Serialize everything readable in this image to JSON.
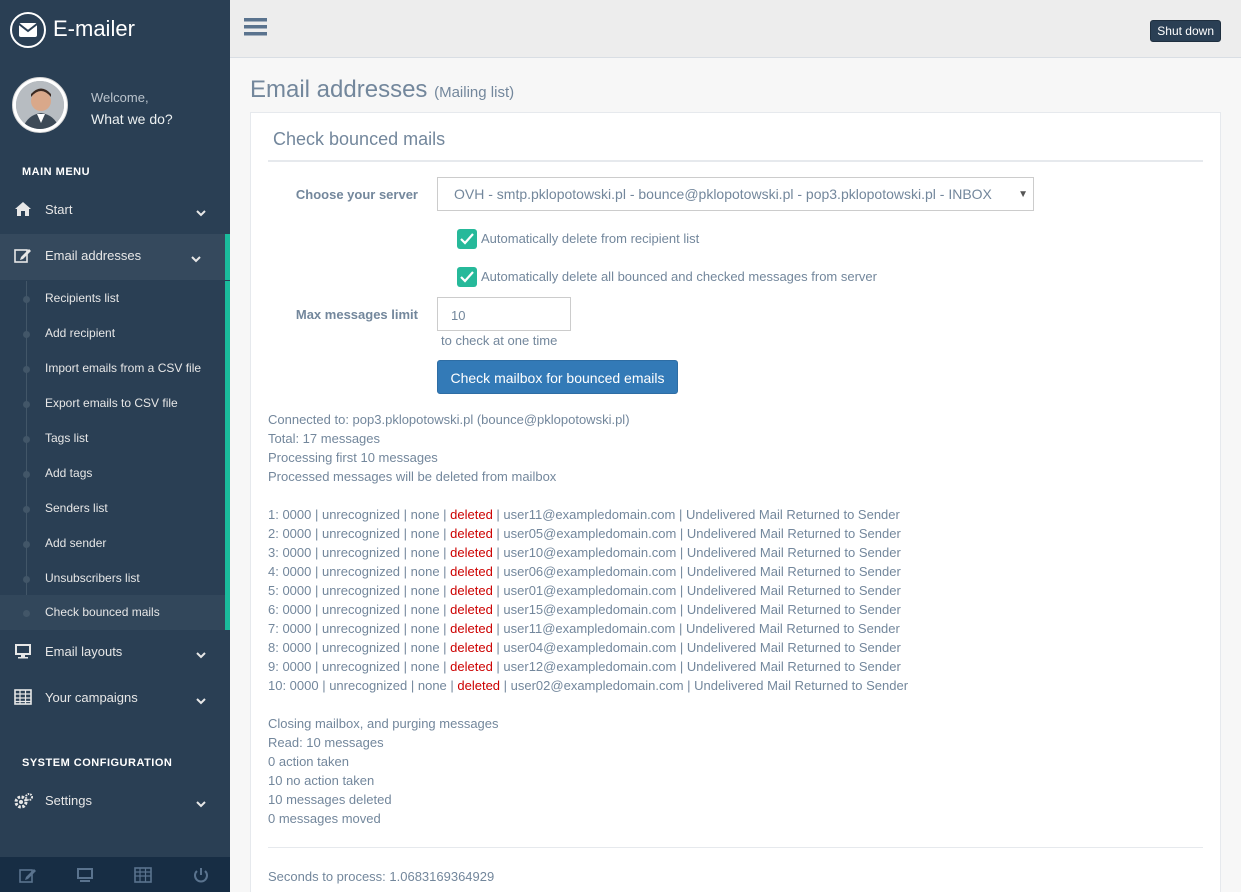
{
  "app": {
    "title": "E-mailer"
  },
  "profile": {
    "welcome": "Welcome,",
    "name": "What we do?"
  },
  "sidebar": {
    "main_menu_title": "MAIN MENU",
    "system_title": "SYSTEM CONFIGURATION",
    "items": [
      {
        "label": "Start",
        "icon": "home-icon"
      },
      {
        "label": "Email addresses",
        "icon": "edit-icon"
      },
      {
        "label": "Email layouts",
        "icon": "desktop-icon"
      },
      {
        "label": "Your campaigns",
        "icon": "table-icon"
      },
      {
        "label": "Settings",
        "icon": "cogs-icon"
      }
    ],
    "submenu": [
      "Recipients list",
      "Add recipient",
      "Import emails from a CSV file",
      "Export emails to CSV file",
      "Tags list",
      "Add tags",
      "Senders list",
      "Add sender",
      "Unsubscribers list",
      "Check bounced mails"
    ],
    "footer_icons": [
      "edit-icon",
      "desktop-icon",
      "table-icon",
      "power-icon"
    ]
  },
  "topnav": {
    "shutdown": "Shut down"
  },
  "page": {
    "title": "Email addresses",
    "subtitle": "(Mailing list)"
  },
  "panel": {
    "title": "Check bounced mails",
    "server_label": "Choose your server",
    "server_value": "OVH - smtp.pklopotowski.pl - bounce@pklopotowski.pl - pop3.pklopotowski.pl - INBOX",
    "check1": "Automatically delete from recipient list",
    "check2": "Automatically delete all bounced and checked messages from server",
    "max_label": "Max messages limit",
    "max_value": "10",
    "max_help": "to check at one time",
    "button": "Check mailbox for bounced emails"
  },
  "log": {
    "header": [
      "Connected to: pop3.pklopotowski.pl (bounce@pklopotowski.pl)",
      "Total: 17 messages",
      "Processing first 10 messages",
      "Processed messages will be deleted from mailbox"
    ],
    "rows": [
      {
        "pre": "1: 0000 | unrecognized | none | ",
        "status": "deleted",
        "post": " | user11@exampledomain.com | Undelivered Mail Returned to Sender"
      },
      {
        "pre": "2: 0000 | unrecognized | none | ",
        "status": "deleted",
        "post": " | user05@exampledomain.com | Undelivered Mail Returned to Sender"
      },
      {
        "pre": "3: 0000 | unrecognized | none | ",
        "status": "deleted",
        "post": " | user10@exampledomain.com | Undelivered Mail Returned to Sender"
      },
      {
        "pre": "4: 0000 | unrecognized | none | ",
        "status": "deleted",
        "post": " | user06@exampledomain.com | Undelivered Mail Returned to Sender"
      },
      {
        "pre": "5: 0000 | unrecognized | none | ",
        "status": "deleted",
        "post": " | user01@exampledomain.com | Undelivered Mail Returned to Sender"
      },
      {
        "pre": "6: 0000 | unrecognized | none | ",
        "status": "deleted",
        "post": " | user15@exampledomain.com | Undelivered Mail Returned to Sender"
      },
      {
        "pre": "7: 0000 | unrecognized | none | ",
        "status": "deleted",
        "post": " | user11@exampledomain.com | Undelivered Mail Returned to Sender"
      },
      {
        "pre": "8: 0000 | unrecognized | none | ",
        "status": "deleted",
        "post": " | user04@exampledomain.com | Undelivered Mail Returned to Sender"
      },
      {
        "pre": "9: 0000 | unrecognized | none | ",
        "status": "deleted",
        "post": " | user12@exampledomain.com | Undelivered Mail Returned to Sender"
      },
      {
        "pre": "10: 0000 | unrecognized | none | ",
        "status": "deleted",
        "post": " | user02@exampledomain.com | Undelivered Mail Returned to Sender"
      }
    ],
    "footer": [
      "Closing mailbox, and purging messages",
      "Read: 10 messages",
      "0 action taken",
      "10 no action taken",
      "10 messages deleted",
      "0 messages moved"
    ],
    "seconds": "Seconds to process: 1.0683169364929"
  },
  "colors": {
    "sidebar": "#2a3f54",
    "accent": "#1abb9c",
    "button": "#337ab7",
    "deleted": "#cc0000"
  }
}
